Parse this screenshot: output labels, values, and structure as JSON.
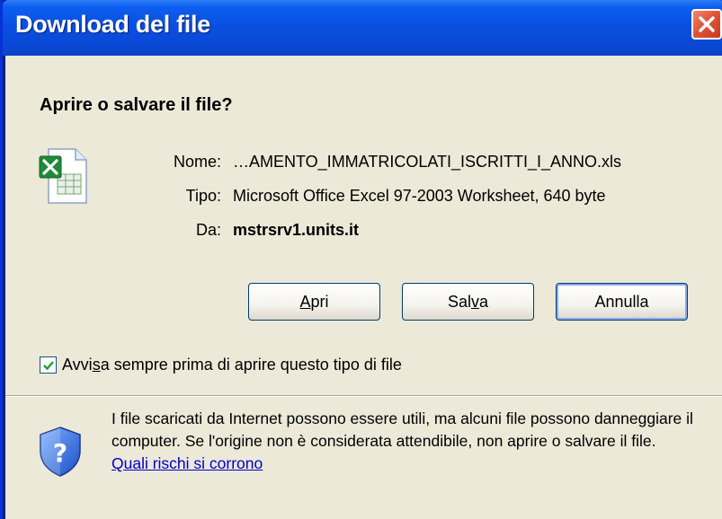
{
  "window": {
    "title": "Download del file"
  },
  "dialog": {
    "heading": "Aprire o salvare il file?",
    "nome_label": "Nome:",
    "nome_value": "…AMENTO_IMMATRICOLATI_ISCRITTI_I_ANNO.xls",
    "tipo_label": "Tipo:",
    "tipo_value": "Microsoft Office Excel 97-2003 Worksheet, 640 byte",
    "da_label": "Da:",
    "da_value": "mstrsrv1.units.it",
    "file_icon": "excel-file-icon"
  },
  "buttons": {
    "apri_pre": "",
    "apri_key": "A",
    "apri_post": "pri",
    "salva_pre": "Sal",
    "salva_key": "v",
    "salva_post": "a",
    "annulla": "Annulla"
  },
  "checkbox": {
    "checked": true,
    "label_pre": "Avvi",
    "label_key": "s",
    "label_post": "a sempre prima di aprire questo tipo di file"
  },
  "warning": {
    "text": "I file scaricati da Internet possono essere utili, ma alcuni file possono danneggiare il computer. Se l'origine non è considerata attendibile, non aprire o salvare il file. ",
    "link": "Quali rischi si corrono",
    "icon": "security-shield-icon"
  },
  "colors": {
    "titlebar": "#0a4fe0",
    "dialog_bg": "#ece9d8",
    "close_button": "#e2553a",
    "link": "#0000cc"
  }
}
